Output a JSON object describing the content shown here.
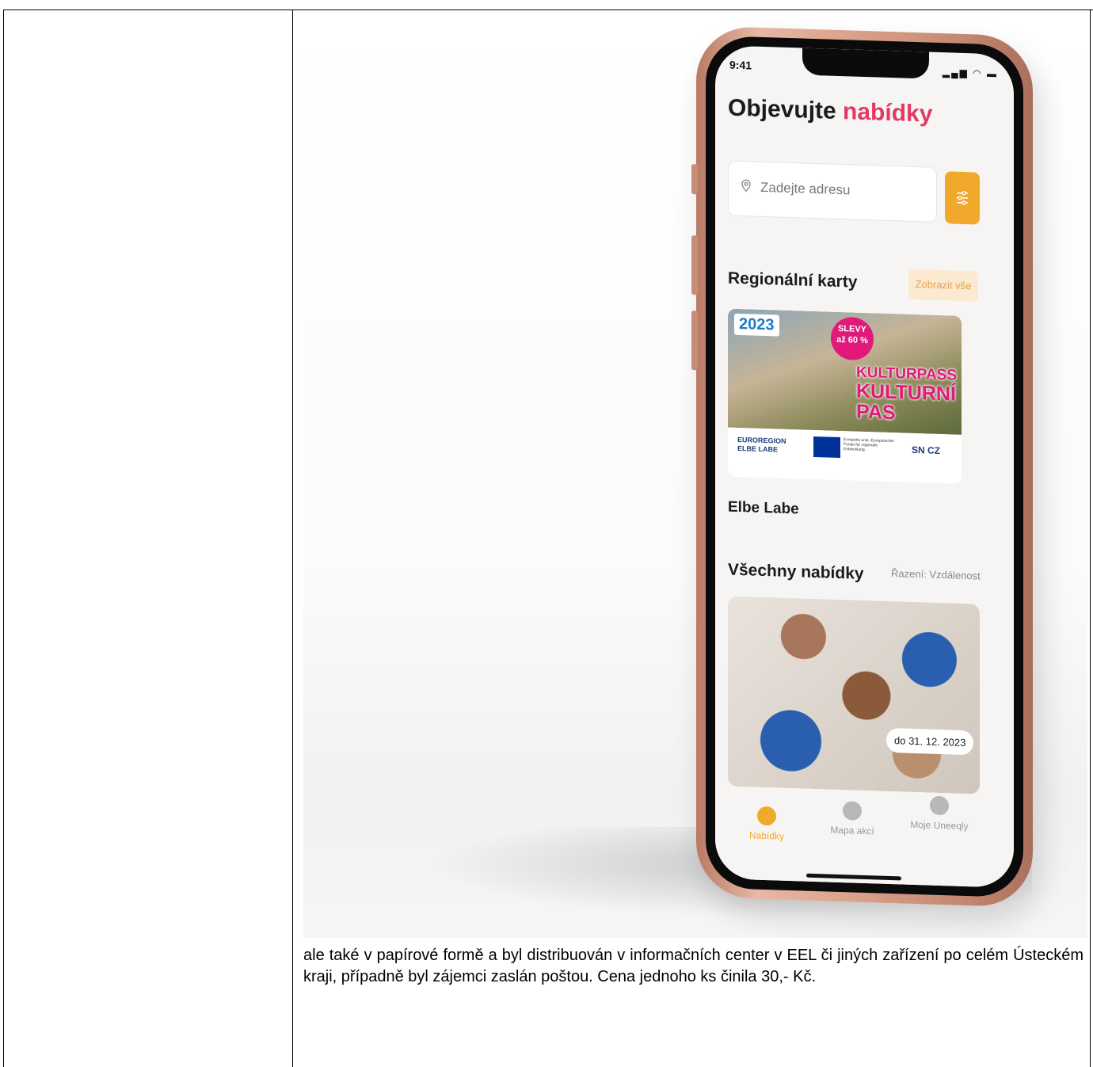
{
  "phone": {
    "status_time": "9:41",
    "title_part1": "Objevujte",
    "title_part2": "nabídky",
    "search_placeholder": "Zadejte adresu",
    "section_regional": "Regionální karty",
    "show_all": "Zobrazit vše",
    "banner": {
      "year": "2023",
      "slevy_1": "SLEVY",
      "slevy_2": "až 60 %",
      "kulturpass": "KULTURPASS",
      "kulturni": "KULTURNÍ",
      "pas": "PAS",
      "euroregion_1": "EUROREGION",
      "euroregion_2": "ELBE LABE",
      "eu_text": "Evropská unie, Europäischer Fonds für regionale Entwicklung",
      "sn_cz": "SN CZ"
    },
    "card_name": "Elbe Labe",
    "section_all": "Všechny nabídky",
    "sort_label": "Řazení: Vzdálenost",
    "deadline": "do 31. 12. 2023",
    "tabs": [
      {
        "label": "Nabídky"
      },
      {
        "label": "Mapa akcí"
      },
      {
        "label": "Moje Uneeqly"
      }
    ],
    "colors": {
      "accent": "#e03a64",
      "orange": "#f1a92b"
    }
  },
  "document": {
    "paragraph": "ale také v  papírové formě a byl distribuován v informačních center v EEL či jiných zařízení po celém Ústeckém kraji, případně byl zájemci zaslán poštou. Cena jednoho ks činila 30,- Kč."
  }
}
